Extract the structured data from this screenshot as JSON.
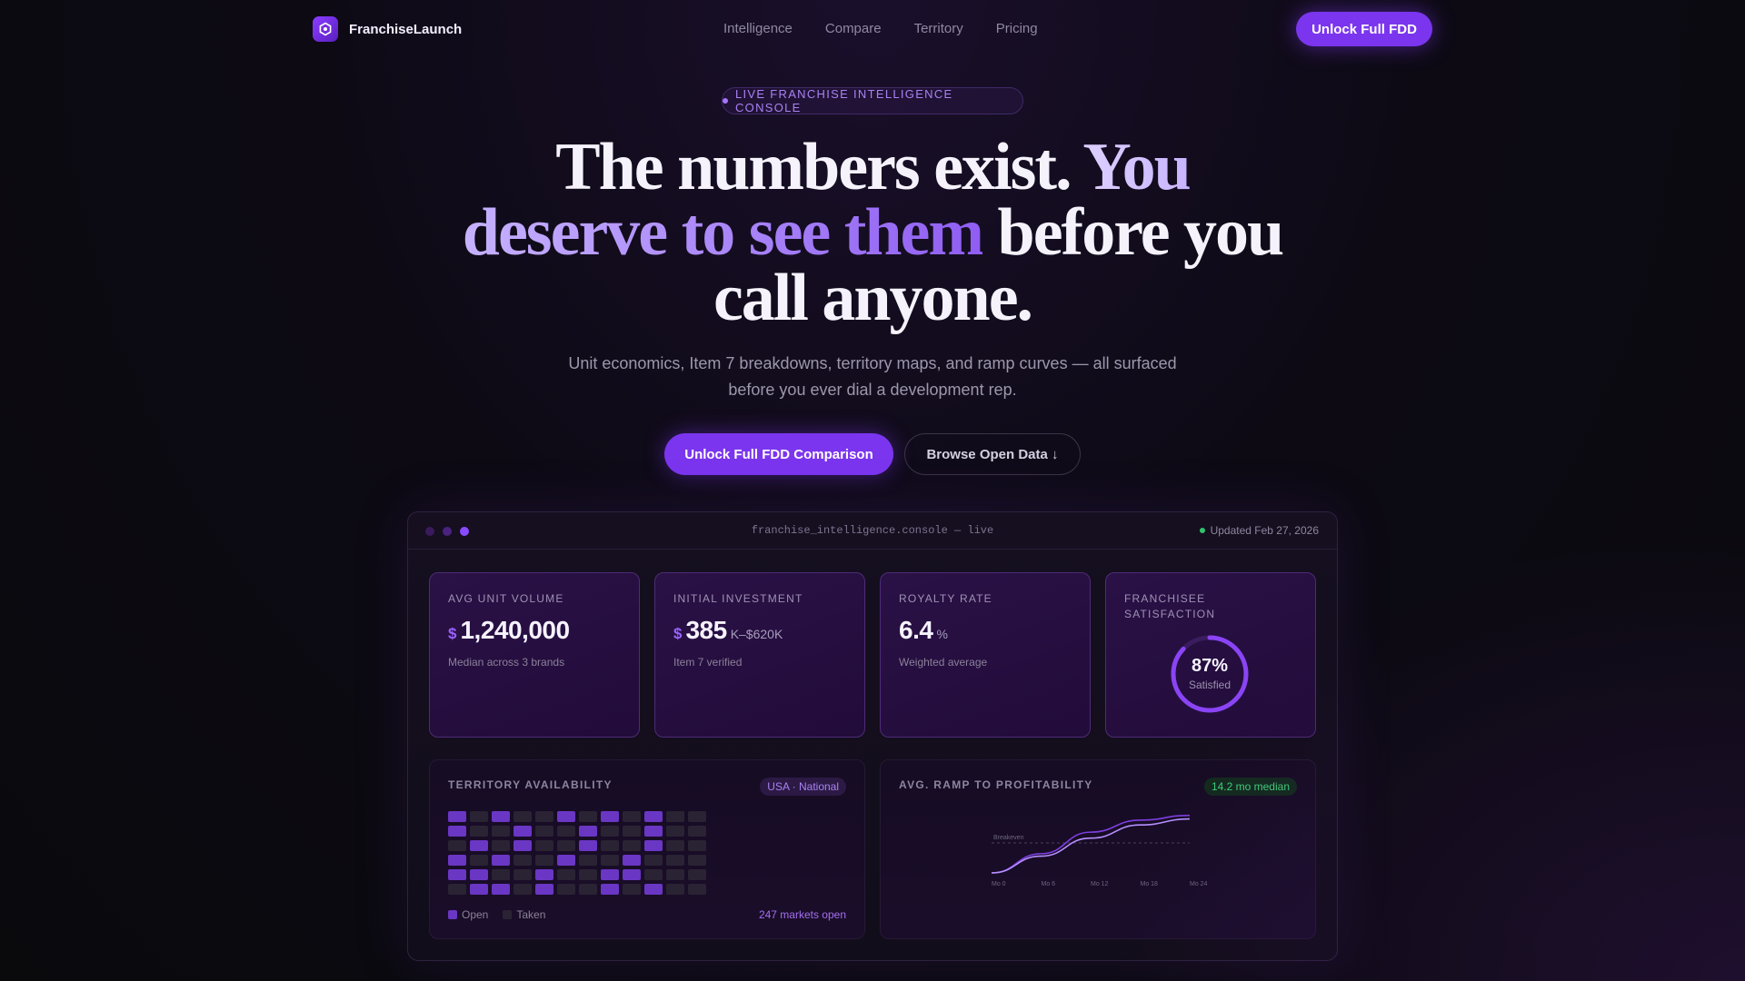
{
  "nav": {
    "brand": "FranchiseLaunch",
    "links": [
      "Intelligence",
      "Compare",
      "Territory",
      "Pricing"
    ],
    "cta": "Unlock Full FDD"
  },
  "hero": {
    "badge": "LIVE FRANCHISE INTELLIGENCE CONSOLE",
    "headline_1": "The numbers exist. ",
    "headline_2": "You",
    "headline_3": "deserve to see them",
    "headline_4": " before you call anyone.",
    "subhead": "Unit economics, Item 7 breakdowns, territory maps, and ramp curves — all surfaced before you ever dial a development rep.",
    "cta_primary": "Unlock Full FDD Comparison",
    "cta_secondary": "Browse Open Data ↓"
  },
  "console": {
    "title": "franchise_intelligence.console — live",
    "updated": "Updated Feb 27, 2026",
    "dot_colors": [
      "#3a1a5c",
      "#4a2380",
      "#8a4bff"
    ],
    "stats": [
      {
        "label": "AVG UNIT VOLUME",
        "prefix": "$",
        "value": "1,240,000",
        "suffix": "",
        "note": "Median across 3 brands"
      },
      {
        "label": "INITIAL INVESTMENT",
        "prefix": "$",
        "value": "385",
        "suffix": "K–$620K",
        "note": "Item 7 verified"
      },
      {
        "label": "ROYALTY RATE",
        "prefix": "",
        "value": "6.4",
        "suffix": "%",
        "note": "Weighted average"
      },
      {
        "label": "FRANCHISEE SATISFACTION",
        "percent": "87%",
        "sublabel": "Satisfied",
        "fraction": 0.87
      }
    ],
    "territory": {
      "title": "TERRITORY AVAILABILITY",
      "pill": "USA · National",
      "legend_open": "Open",
      "legend_taken": "Taken",
      "markets": "247 markets open",
      "open_color": "#6a36c4",
      "taken_color": "#2a2333",
      "grid": [
        [
          1,
          0,
          1,
          0,
          0,
          1,
          0,
          1,
          0,
          1,
          0,
          0
        ],
        [
          1,
          0,
          0,
          1,
          0,
          0,
          1,
          0,
          0,
          1,
          0,
          0
        ],
        [
          0,
          1,
          0,
          1,
          0,
          0,
          1,
          0,
          0,
          1,
          0,
          0
        ],
        [
          1,
          0,
          1,
          0,
          0,
          1,
          0,
          0,
          1,
          0,
          0,
          0
        ],
        [
          1,
          1,
          0,
          0,
          1,
          0,
          0,
          1,
          1,
          0,
          0,
          0
        ],
        [
          0,
          1,
          1,
          0,
          1,
          0,
          0,
          1,
          0,
          1,
          0,
          0
        ]
      ]
    },
    "ramp": {
      "title": "AVG. RAMP TO PROFITABILITY",
      "pill": "14.2 mo median",
      "breakeven_label": "Breakeven"
    }
  },
  "chart_data": {
    "type": "line",
    "x": [
      "Mo 0",
      "Mo 6",
      "Mo 12",
      "Mo 18",
      "Mo 24"
    ],
    "series": [
      {
        "values": [
          0,
          32,
          68,
          88,
          96
        ]
      },
      {
        "values": [
          0,
          28,
          58,
          80,
          90
        ]
      }
    ],
    "breakeven": 50,
    "ylim": [
      0,
      100
    ],
    "colors": [
      "#7d3fe0",
      "#b690ff"
    ]
  }
}
